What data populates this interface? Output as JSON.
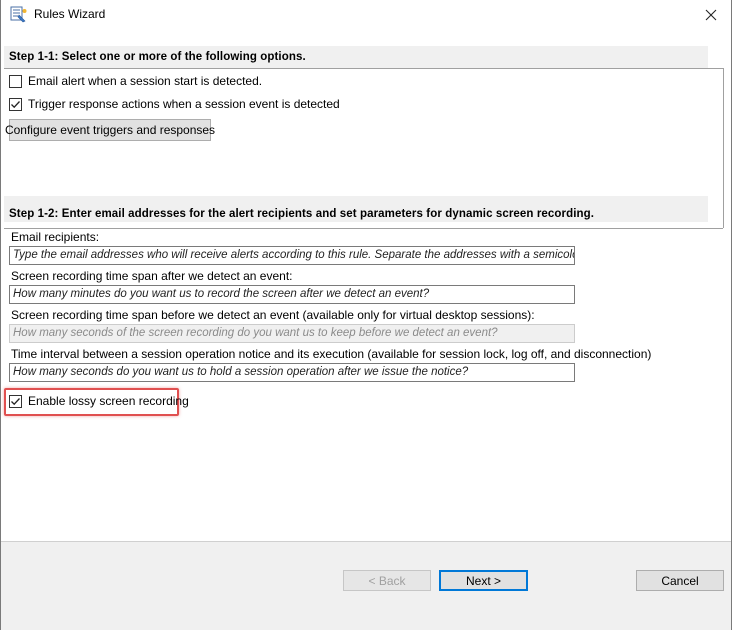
{
  "window": {
    "title": "Rules Wizard",
    "icon": "rules-wizard-icon",
    "close_icon": "close-icon"
  },
  "step1": {
    "header": "Step 1-1: Select one or more of the following options.",
    "options": [
      {
        "label": "Email alert when a session start is detected.",
        "checked": false
      },
      {
        "label": "Trigger response actions when a session event is detected",
        "checked": true
      }
    ],
    "configure_button": "Configure event triggers and responses"
  },
  "step2": {
    "header": "Step 1-2: Enter email addresses for the alert recipients and set parameters for dynamic screen recording.",
    "fields": [
      {
        "label": "Email recipients:",
        "placeholder": "Type the email addresses who will receive alerts according to this rule. Separate the addresses with a semicolon (;).",
        "enabled": true
      },
      {
        "label": "Screen recording time span after we detect an event:",
        "placeholder": "How many minutes do you want us to record the screen after we detect an event?",
        "enabled": true
      },
      {
        "label": "Screen recording time span before we detect an event (available only for virtual desktop sessions):",
        "placeholder": "How many seconds of the screen recording do you want us to keep before we detect an event?",
        "enabled": false
      },
      {
        "label": "Time interval between a session operation notice and its execution (available for session lock, log off, and disconnection)",
        "placeholder": "How many seconds do you want us to hold a session operation after we issue the notice?",
        "enabled": true
      }
    ],
    "lossy_option": {
      "label": "Enable lossy screen recording",
      "checked": true
    },
    "highlight_color": "#e05050"
  },
  "footer": {
    "back_label": "< Back",
    "back_enabled": false,
    "next_label": "Next >",
    "cancel_label": "Cancel"
  },
  "colors": {
    "accent": "#0078d7",
    "header_bg": "#f0f0f0"
  }
}
